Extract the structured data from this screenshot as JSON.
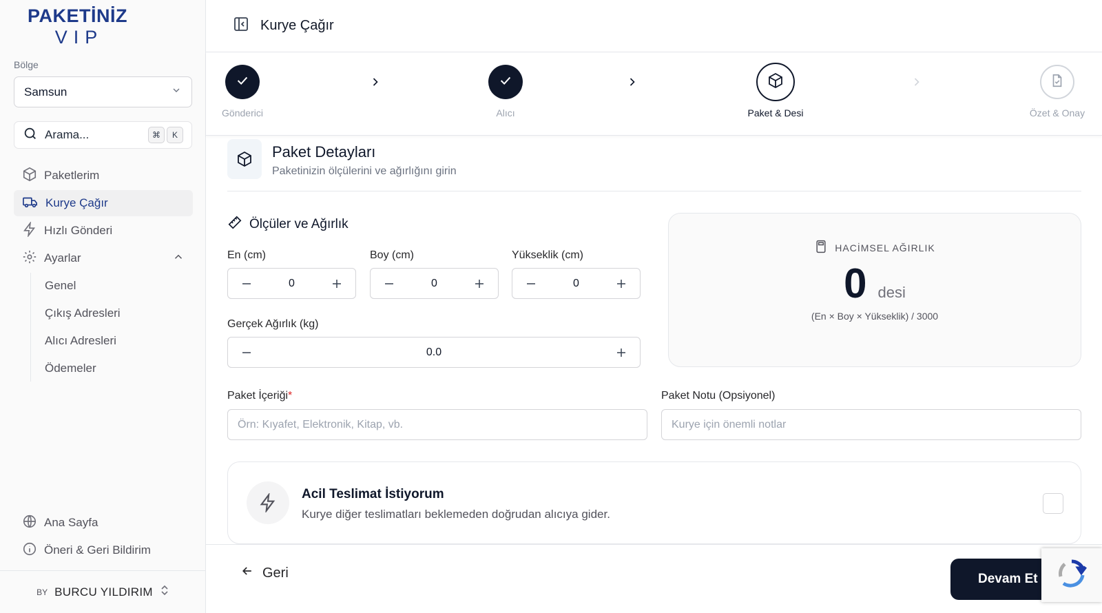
{
  "brand": {
    "name_top": "PAKETİNİZ",
    "name_sub": "VIP"
  },
  "sidebar": {
    "region_label": "Bölge",
    "region_value": "Samsun",
    "search": {
      "placeholder": "Arama...",
      "kbd_cmd": "⌘",
      "kbd_key": "K"
    },
    "items": [
      {
        "label": "Paketlerim",
        "icon": "package-icon"
      },
      {
        "label": "Kurye Çağır",
        "icon": "truck-icon",
        "active": true
      },
      {
        "label": "Hızlı Gönderi",
        "icon": "zap-icon"
      },
      {
        "label": "Ayarlar",
        "icon": "gear-icon",
        "expanded": true
      }
    ],
    "settings_sub": [
      "Genel",
      "Çıkış Adresleri",
      "Alıcı Adresleri",
      "Ödemeler"
    ],
    "bottom": [
      {
        "label": "Ana Sayfa",
        "icon": "globe-icon"
      },
      {
        "label": "Öneri & Geri Bildirim",
        "icon": "info-icon"
      }
    ],
    "user": {
      "initials": "BY",
      "name": "BURCU YILDIRIM"
    }
  },
  "header": {
    "title": "Kurye Çağır"
  },
  "steps": [
    {
      "label": "Gönderici",
      "state": "done"
    },
    {
      "label": "Alıcı",
      "state": "done"
    },
    {
      "label": "Paket & Desi",
      "state": "current"
    },
    {
      "label": "Özet & Onay",
      "state": "pending"
    }
  ],
  "section": {
    "title": "Paket Detayları",
    "subtitle": "Paketinizin ölçülerini ve ağırlığını girin"
  },
  "dimensions": {
    "title": "Ölçüler ve Ağırlık",
    "width": {
      "label": "En (cm)",
      "value": "0"
    },
    "length": {
      "label": "Boy (cm)",
      "value": "0"
    },
    "height": {
      "label": "Yükseklik (cm)",
      "value": "0"
    },
    "weight": {
      "label": "Gerçek Ağırlık (kg)",
      "value": "0.0"
    }
  },
  "volumetric": {
    "title": "HACİMSEL AĞIRLIK",
    "value": "0",
    "unit": "desi",
    "formula": "(En × Boy × Yükseklik) / 3000"
  },
  "content_field": {
    "label": "Paket İçeriği",
    "required_mark": "*",
    "placeholder": "Örn: Kıyafet, Elektronik, Kitap, vb."
  },
  "note_field": {
    "label": "Paket Notu (Opsiyonel)",
    "placeholder": "Kurye için önemli notlar"
  },
  "urgent": {
    "title": "Acil Teslimat İstiyorum",
    "description": "Kurye diğer teslimatları beklemeden doğrudan alıcıya gider.",
    "checked": false
  },
  "footer": {
    "back_label": "Geri",
    "next_label": "Devam Et"
  },
  "colors": {
    "primary": "#0f172a",
    "brand": "#1e3a8a",
    "muted": "#9ca3af"
  }
}
